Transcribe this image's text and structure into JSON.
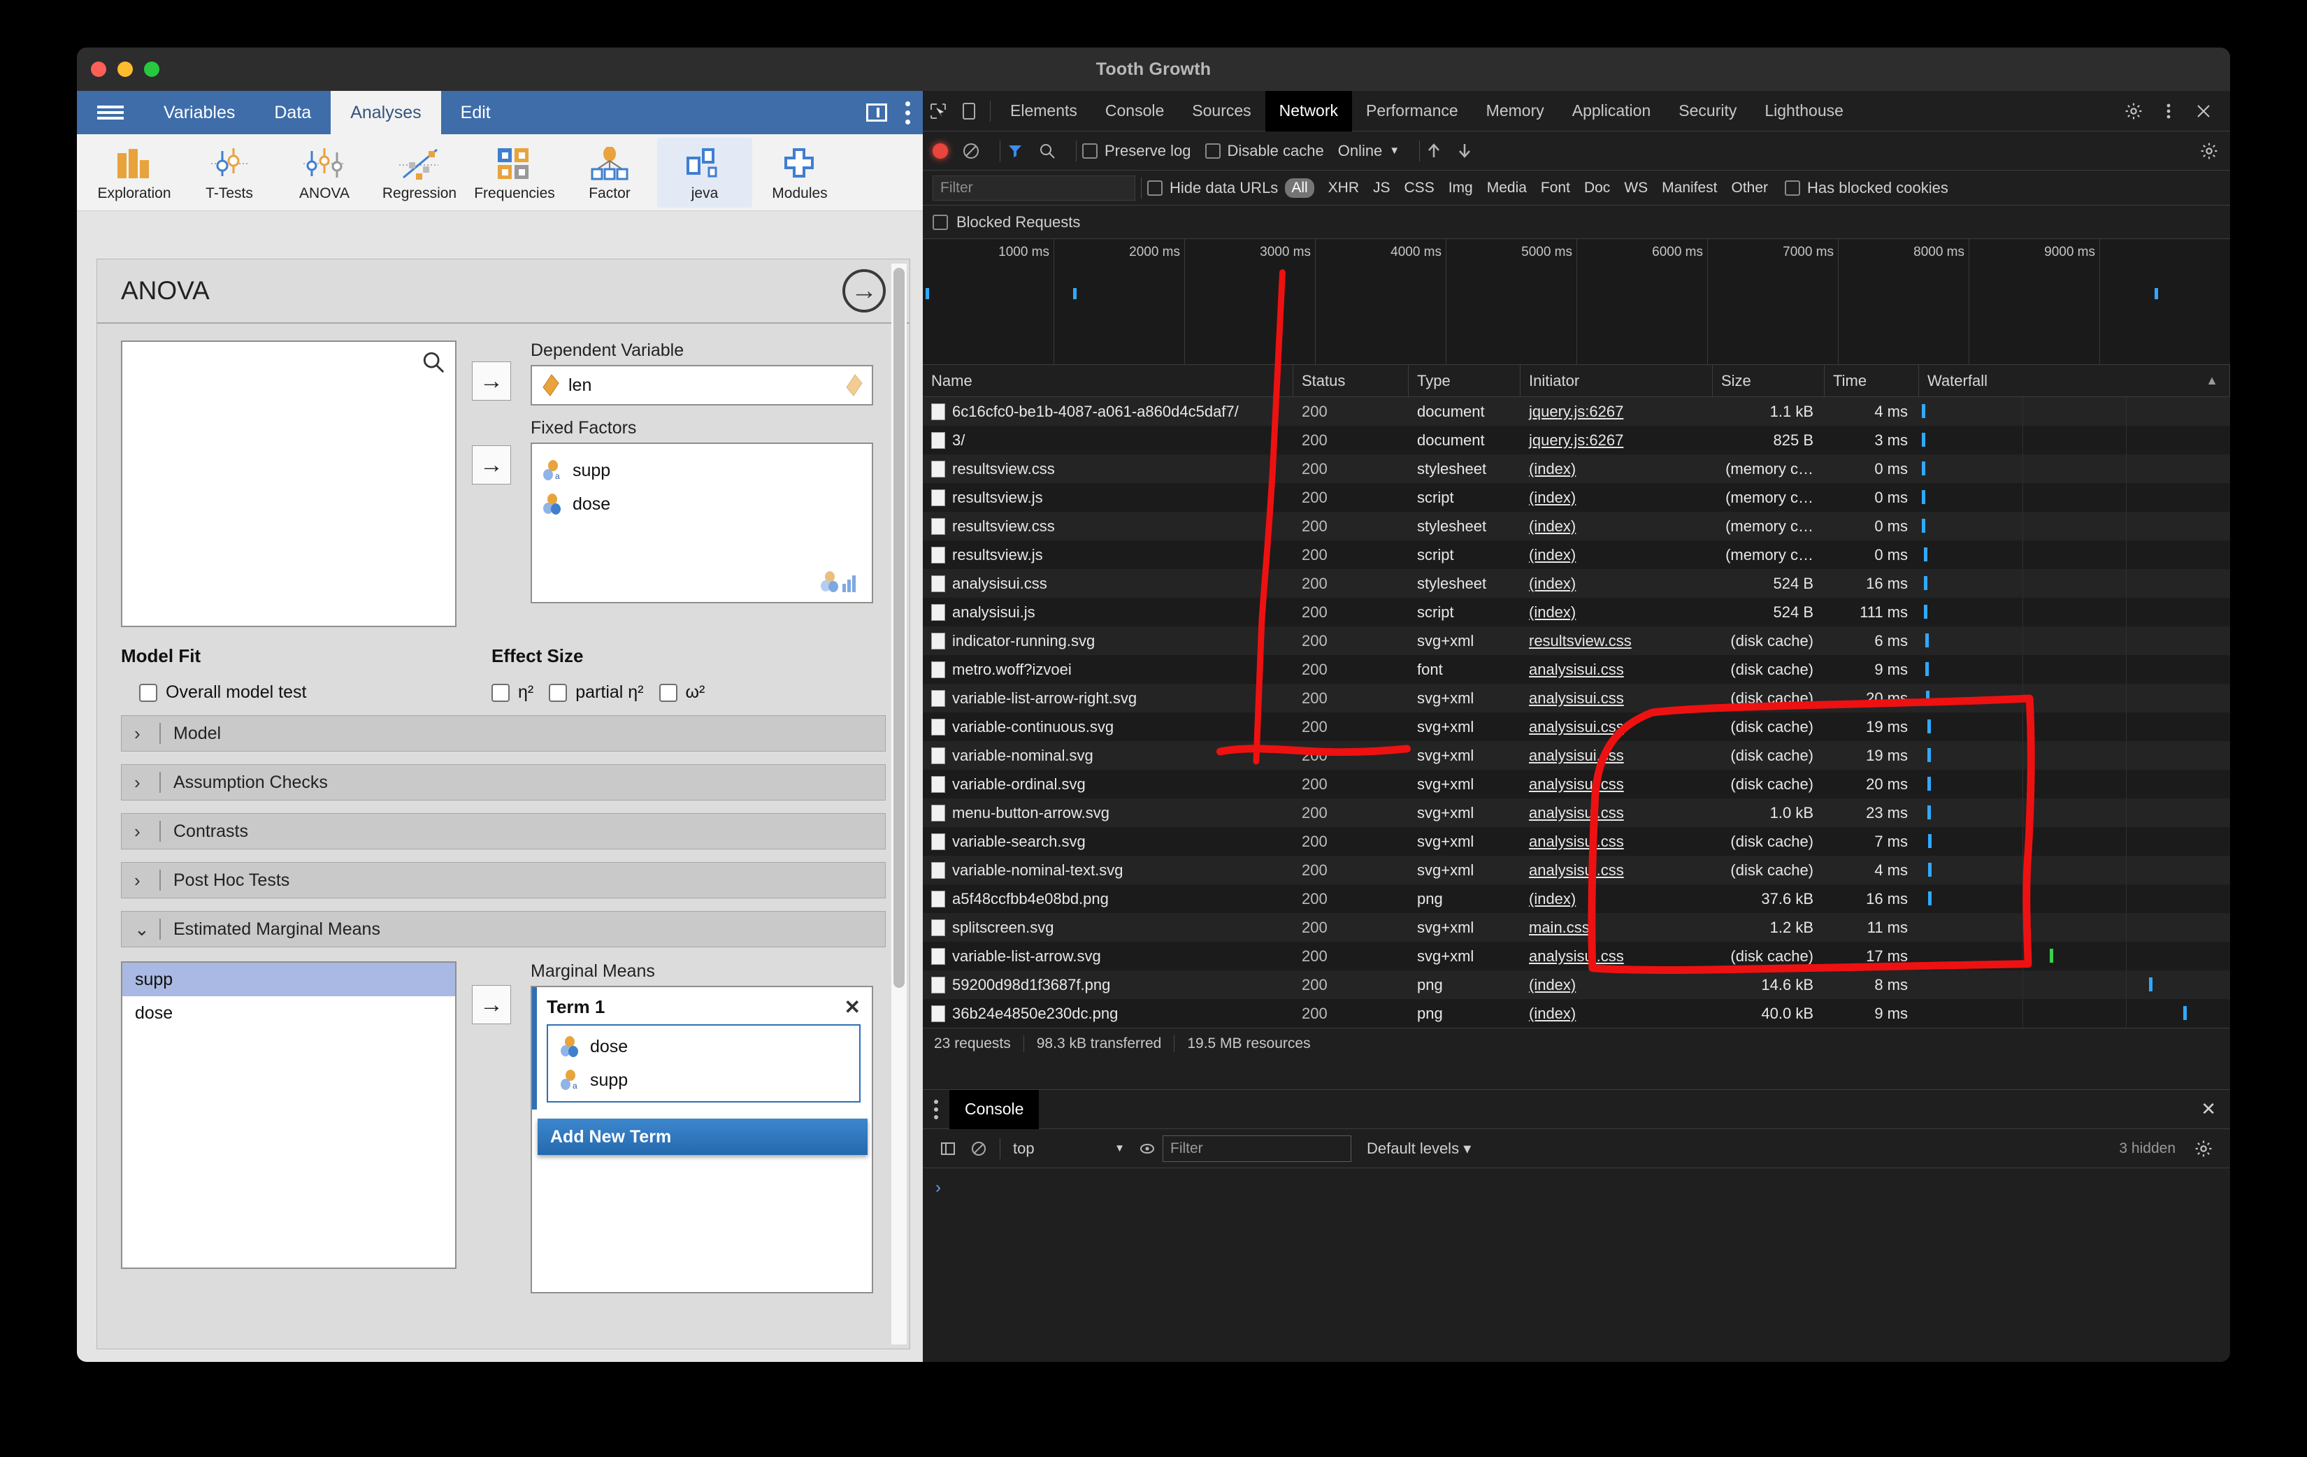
{
  "window": {
    "title": "Tooth Growth"
  },
  "jamovi": {
    "tabs": [
      {
        "label": "Variables",
        "active": false
      },
      {
        "label": "Data",
        "active": false
      },
      {
        "label": "Analyses",
        "active": true
      },
      {
        "label": "Edit",
        "active": false
      }
    ],
    "ribbon": [
      {
        "label": "Exploration",
        "icon": "bar-chart-icon",
        "selected": false
      },
      {
        "label": "T-Tests",
        "icon": "t-test-icon",
        "selected": false
      },
      {
        "label": "ANOVA",
        "icon": "anova-icon",
        "selected": false
      },
      {
        "label": "Regression",
        "icon": "regression-icon",
        "selected": false
      },
      {
        "label": "Frequencies",
        "icon": "frequencies-icon",
        "selected": false
      },
      {
        "label": "Factor",
        "icon": "factor-icon",
        "selected": false
      },
      {
        "label": "jeva",
        "icon": "jeva-icon",
        "selected": true
      },
      {
        "label": "Modules",
        "icon": "plus-icon",
        "selected": false
      }
    ],
    "analysis": {
      "title": "ANOVA",
      "dependent_label": "Dependent Variable",
      "dependent_value": "len",
      "fixed_label": "Fixed Factors",
      "fixed_factors": [
        "supp",
        "dose"
      ],
      "model_fit_label": "Model Fit",
      "overall_model_test": "Overall model test",
      "effect_size_label": "Effect Size",
      "effect_sizes": [
        "η²",
        "partial η²",
        "ω²"
      ],
      "sections": [
        {
          "label": "Model",
          "expanded": false
        },
        {
          "label": "Assumption Checks",
          "expanded": false
        },
        {
          "label": "Contrasts",
          "expanded": false
        },
        {
          "label": "Post Hoc Tests",
          "expanded": false
        },
        {
          "label": "Estimated Marginal Means",
          "expanded": true
        }
      ],
      "emm_available": [
        {
          "label": "supp",
          "selected": true
        },
        {
          "label": "dose",
          "selected": false
        }
      ],
      "marginal_means_label": "Marginal Means",
      "term_title": "Term 1",
      "term_items": [
        "dose",
        "supp"
      ],
      "add_new_term": "Add New Term"
    }
  },
  "devtools": {
    "panels": [
      "Elements",
      "Console",
      "Sources",
      "Network",
      "Performance",
      "Memory",
      "Application",
      "Security",
      "Lighthouse"
    ],
    "active_panel": "Network",
    "toolbar": {
      "preserve_log": "Preserve log",
      "disable_cache": "Disable cache",
      "throttling": "Online"
    },
    "filterbar": {
      "filter_placeholder": "Filter",
      "hide_data_urls": "Hide data URLs",
      "types": [
        "All",
        "XHR",
        "JS",
        "CSS",
        "Img",
        "Media",
        "Font",
        "Doc",
        "WS",
        "Manifest",
        "Other"
      ],
      "active_type": "All",
      "has_blocked_cookies": "Has blocked cookies",
      "blocked_requests": "Blocked Requests"
    },
    "overview": {
      "ticks": [
        "1000 ms",
        "2000 ms",
        "3000 ms",
        "4000 ms",
        "5000 ms",
        "6000 ms",
        "7000 ms",
        "8000 ms",
        "9000 ms"
      ]
    },
    "columns": [
      "Name",
      "Status",
      "Type",
      "Initiator",
      "Size",
      "Time",
      "Waterfall"
    ],
    "requests": [
      {
        "name": "6c16cfc0-be1b-4087-a061-a860d4c5daf7/",
        "icon": "document-icon",
        "status": "200",
        "type": "document",
        "initiator": "jquery.js:6267",
        "size": "1.1 kB",
        "time": "4 ms",
        "wf_left": 1.0,
        "wf_color": "blue"
      },
      {
        "name": "3/",
        "icon": "document-icon",
        "status": "200",
        "type": "document",
        "initiator": "jquery.js:6267",
        "size": "825 B",
        "time": "3 ms",
        "wf_left": 1.0,
        "wf_color": "blue"
      },
      {
        "name": "resultsview.css",
        "icon": "document-icon",
        "status": "200",
        "type": "stylesheet",
        "initiator": "(index)",
        "size": "(memory c…",
        "time": "0 ms",
        "wf_left": 1.0,
        "wf_color": "blue"
      },
      {
        "name": "resultsview.js",
        "icon": "document-icon",
        "status": "200",
        "type": "script",
        "initiator": "(index)",
        "size": "(memory c…",
        "time": "0 ms",
        "wf_left": 1.0,
        "wf_color": "blue"
      },
      {
        "name": "resultsview.css",
        "icon": "document-icon",
        "status": "200",
        "type": "stylesheet",
        "initiator": "(index)",
        "size": "(memory c…",
        "time": "0 ms",
        "wf_left": 1.0,
        "wf_color": "blue"
      },
      {
        "name": "resultsview.js",
        "icon": "document-icon",
        "status": "200",
        "type": "script",
        "initiator": "(index)",
        "size": "(memory c…",
        "time": "0 ms",
        "wf_left": 1.5,
        "wf_color": "blue"
      },
      {
        "name": "analysisui.css",
        "icon": "document-icon",
        "status": "200",
        "type": "stylesheet",
        "initiator": "(index)",
        "size": "524 B",
        "time": "16 ms",
        "wf_left": 1.5,
        "wf_color": "blue"
      },
      {
        "name": "analysisui.js",
        "icon": "document-icon",
        "status": "200",
        "type": "script",
        "initiator": "(index)",
        "size": "524 B",
        "time": "111 ms",
        "wf_left": 1.5,
        "wf_color": "blue"
      },
      {
        "name": "indicator-running.svg",
        "icon": "spinner-icon",
        "status": "200",
        "type": "svg+xml",
        "initiator": "resultsview.css",
        "size": "(disk cache)",
        "time": "6 ms",
        "wf_left": 2.0,
        "wf_color": "blue"
      },
      {
        "name": "metro.woff?izvoei",
        "icon": "font-icon",
        "status": "200",
        "type": "font",
        "initiator": "analysisui.css",
        "size": "(disk cache)",
        "time": "9 ms",
        "wf_left": 2.0,
        "wf_color": "blue"
      },
      {
        "name": "variable-list-arrow-right.svg",
        "icon": "arrow-right-icon",
        "status": "200",
        "type": "svg+xml",
        "initiator": "analysisui.css",
        "size": "(disk cache)",
        "time": "20 ms",
        "wf_left": 2.2,
        "wf_color": "blue"
      },
      {
        "name": "variable-continuous.svg",
        "icon": "continuous-icon",
        "status": "200",
        "type": "svg+xml",
        "initiator": "analysisui.css",
        "size": "(disk cache)",
        "time": "19 ms",
        "wf_left": 2.6,
        "wf_color": "blue"
      },
      {
        "name": "variable-nominal.svg",
        "icon": "nominal-icon",
        "status": "200",
        "type": "svg+xml",
        "initiator": "analysisui.css",
        "size": "(disk cache)",
        "time": "19 ms",
        "wf_left": 2.6,
        "wf_color": "blue"
      },
      {
        "name": "variable-ordinal.svg",
        "icon": "ordinal-icon",
        "status": "200",
        "type": "svg+xml",
        "initiator": "analysisui.css",
        "size": "(disk cache)",
        "time": "20 ms",
        "wf_left": 2.8,
        "wf_color": "blue"
      },
      {
        "name": "menu-button-arrow.svg",
        "icon": "chevron-down-icon",
        "status": "200",
        "type": "svg+xml",
        "initiator": "analysisui.css",
        "size": "1.0 kB",
        "time": "23 ms",
        "wf_left": 2.8,
        "wf_color": "blue"
      },
      {
        "name": "variable-search.svg",
        "icon": "search-icon",
        "status": "200",
        "type": "svg+xml",
        "initiator": "analysisui.css",
        "size": "(disk cache)",
        "time": "7 ms",
        "wf_left": 3.0,
        "wf_color": "blue"
      },
      {
        "name": "variable-nominal-text.svg",
        "icon": "nominal-text-icon",
        "status": "200",
        "type": "svg+xml",
        "initiator": "analysisui.css",
        "size": "(disk cache)",
        "time": "4 ms",
        "wf_left": 3.0,
        "wf_color": "blue"
      },
      {
        "name": "a5f48ccfbb4e08bd.png",
        "icon": "image-icon",
        "status": "200",
        "type": "png",
        "initiator": "(index)",
        "size": "37.6 kB",
        "time": "16 ms",
        "wf_left": 3.0,
        "wf_color": "blue"
      },
      {
        "name": "splitscreen.svg",
        "icon": "blank-icon",
        "status": "200",
        "type": "svg+xml",
        "initiator": "main.css",
        "size": "1.2 kB",
        "time": "11 ms",
        "wf_left": 34.5,
        "wf_color": "blue"
      },
      {
        "name": "variable-list-arrow.svg",
        "icon": "arrow-left-icon",
        "status": "200",
        "type": "svg+xml",
        "initiator": "analysisui.css",
        "size": "(disk cache)",
        "time": "17 ms",
        "wf_left": 42.0,
        "wf_color": "green"
      },
      {
        "name": "59200d98d1f3687f.png",
        "icon": "image-icon",
        "status": "200",
        "type": "png",
        "initiator": "(index)",
        "size": "14.6 kB",
        "time": "8 ms",
        "wf_left": 74.0,
        "wf_color": "blue"
      },
      {
        "name": "36b24e4850e230dc.png",
        "icon": "image-icon",
        "status": "200",
        "type": "png",
        "initiator": "(index)",
        "size": "40.0 kB",
        "time": "9 ms",
        "wf_left": 85.0,
        "wf_color": "blue"
      }
    ],
    "status": {
      "requests": "23 requests",
      "transferred": "98.3 kB transferred",
      "resources": "19.5 MB resources"
    },
    "console": {
      "tab": "Console",
      "context": "top",
      "filter_placeholder": "Filter",
      "levels": "Default levels",
      "hidden": "3 hidden",
      "prompt": "›"
    }
  },
  "colors": {
    "jamovi_blue": "#3E6DA9",
    "waterfall_blue": "#31a8ff",
    "waterfall_green": "#3ad04a",
    "record_red": "#e8453c",
    "annotation_red": "#ee1111"
  }
}
